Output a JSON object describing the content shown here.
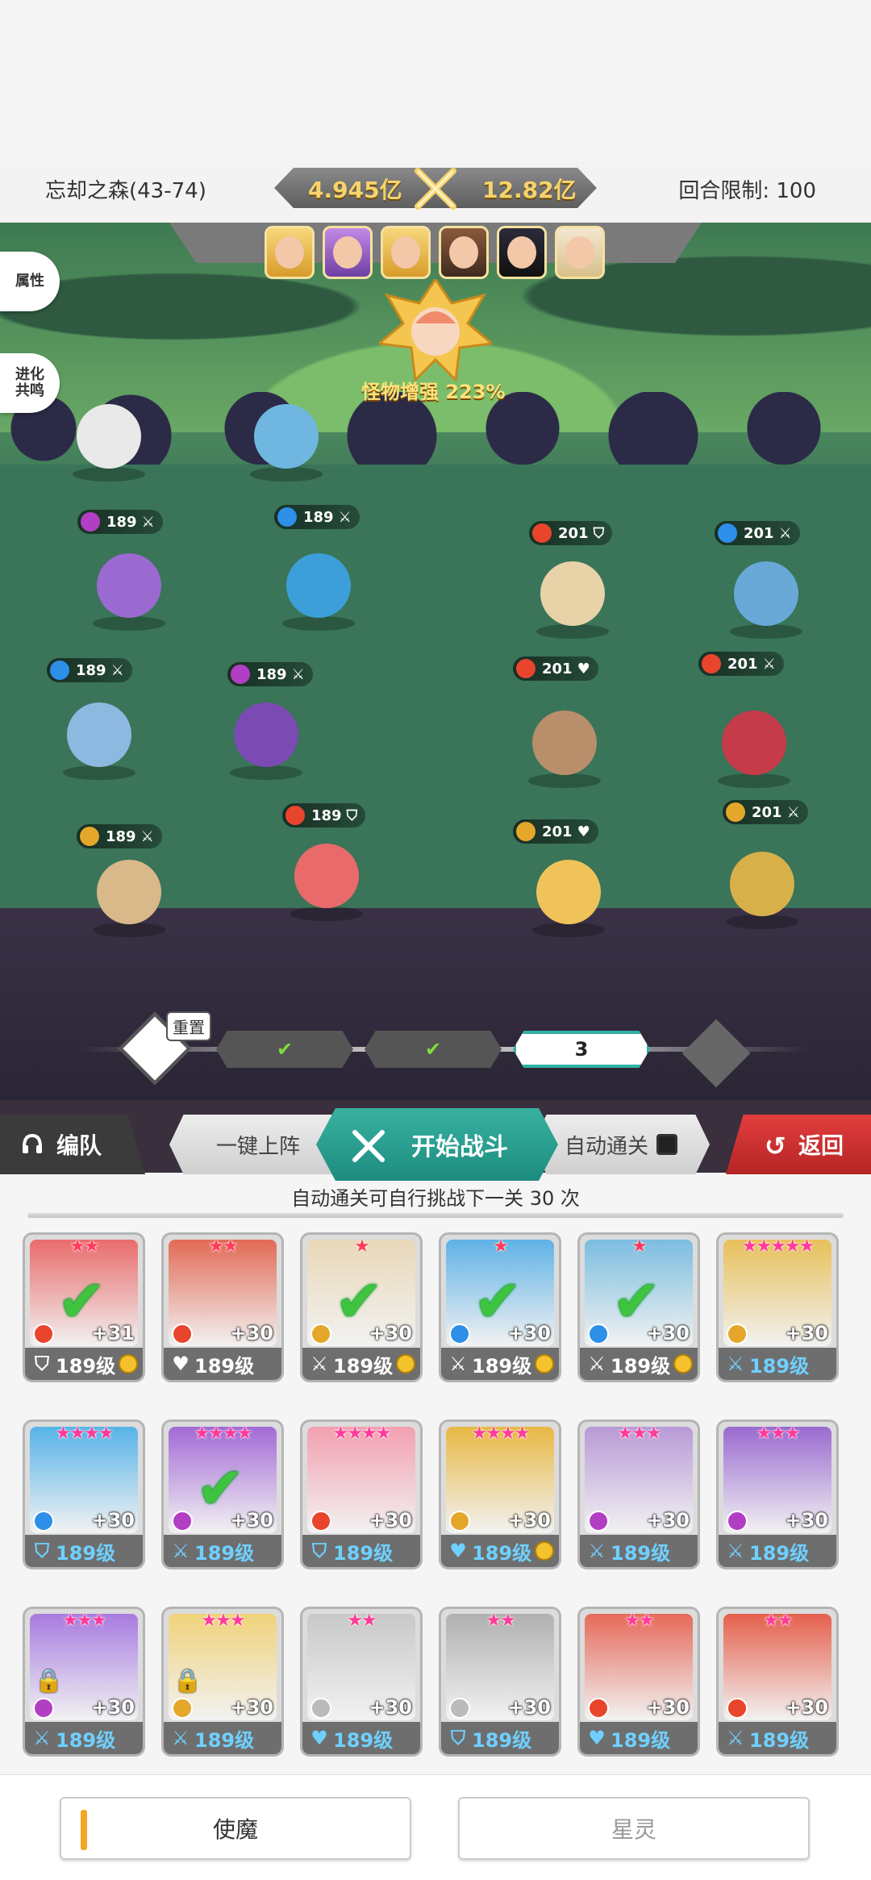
{
  "header": {
    "stage_name": "忘却之森(43-74)",
    "power_left": "4.945亿",
    "power_right": "12.82亿",
    "round_limit": "回合限制: 100"
  },
  "battle": {
    "side_buttons": [
      "属性",
      "进化\n共鸣"
    ],
    "boss_buff": "怪物增强 223%",
    "enemy_portraits": 6,
    "ally_tags": [
      {
        "level": "189",
        "element": "moon",
        "role": "sword"
      },
      {
        "level": "189",
        "element": "water",
        "role": "sword"
      },
      {
        "level": "189",
        "element": "water",
        "role": "sword"
      },
      {
        "level": "189",
        "element": "moon",
        "role": "sword"
      },
      {
        "level": "189",
        "element": "fire",
        "role": "shield"
      },
      {
        "level": "189",
        "element": "wind",
        "role": "sword"
      }
    ],
    "enemy_tags": [
      {
        "level": "201",
        "element": "fire",
        "role": "shield"
      },
      {
        "level": "201",
        "element": "water",
        "role": "sword"
      },
      {
        "level": "201",
        "element": "fire",
        "role": "heart"
      },
      {
        "level": "201",
        "element": "fire",
        "role": "sword"
      },
      {
        "level": "201",
        "element": "wind",
        "role": "sword"
      },
      {
        "level": "201",
        "element": "wind",
        "role": "heart"
      }
    ]
  },
  "stages": {
    "reset_label": "重置",
    "current": "3"
  },
  "actions": {
    "team_label": "编队",
    "one_click_label": "一键上阵",
    "start_label": "开始战斗",
    "auto_label": "自动通关",
    "back_label": "返回"
  },
  "auto_info": "自动通关可自行挑战下一关 30 次",
  "roster": [
    {
      "stars": "★★",
      "bonus": "+31",
      "level": "189级",
      "checked": true,
      "elem_color": "#e8452c",
      "role": "shield",
      "coin": true,
      "blue": false,
      "art": "#e96b6b",
      "star_color": "#ff3b5c"
    },
    {
      "stars": "★★",
      "bonus": "+30",
      "level": "189级",
      "checked": false,
      "elem_color": "#e8452c",
      "role": "heart",
      "coin": false,
      "blue": false,
      "art": "#e26a55",
      "star_color": "#ff3b5c"
    },
    {
      "stars": "★",
      "bonus": "+30",
      "level": "189级",
      "checked": true,
      "elem_color": "#e4a72a",
      "role": "sword",
      "coin": true,
      "blue": false,
      "art": "#e9d8b8",
      "star_color": "#ff3b5c"
    },
    {
      "stars": "★",
      "bonus": "+30",
      "level": "189级",
      "checked": true,
      "elem_color": "#2d8fe8",
      "role": "sword",
      "coin": true,
      "blue": false,
      "art": "#5fb2e6",
      "star_color": "#ff3b5c"
    },
    {
      "stars": "★",
      "bonus": "+30",
      "level": "189级",
      "checked": true,
      "elem_color": "#2d8fe8",
      "role": "sword",
      "coin": true,
      "blue": false,
      "art": "#7bbde0",
      "star_color": "#ff3b5c"
    },
    {
      "stars": "★★★★★",
      "bonus": "+30",
      "level": "189级",
      "checked": false,
      "elem_color": "#e4a72a",
      "role": "sword",
      "coin": false,
      "blue": true,
      "art": "#e8c05a",
      "star_color": "#ff3b9a"
    },
    {
      "stars": "★★★★",
      "bonus": "+30",
      "level": "189级",
      "checked": false,
      "elem_color": "#2d8fe8",
      "role": "shield",
      "coin": false,
      "blue": true,
      "art": "#56b3e8",
      "star_color": "#ff3b9a"
    },
    {
      "stars": "★★★★",
      "bonus": "+30",
      "level": "189级",
      "checked": true,
      "elem_color": "#b23ec4",
      "role": "sword",
      "coin": false,
      "blue": true,
      "art": "#a36ad6",
      "star_color": "#ff3b9a"
    },
    {
      "stars": "★★★★",
      "bonus": "+30",
      "level": "189级",
      "checked": false,
      "elem_color": "#e8452c",
      "role": "shield",
      "coin": false,
      "blue": true,
      "art": "#f2a0b0",
      "star_color": "#ff3b9a"
    },
    {
      "stars": "★★★★",
      "bonus": "+30",
      "level": "189级",
      "checked": false,
      "elem_color": "#e4a72a",
      "role": "heart",
      "coin": true,
      "blue": true,
      "art": "#e8b845",
      "star_color": "#ff3b9a"
    },
    {
      "stars": "★★★",
      "bonus": "+30",
      "level": "189级",
      "checked": false,
      "elem_color": "#b23ec4",
      "role": "sword",
      "coin": false,
      "blue": true,
      "art": "#b89ad6",
      "star_color": "#ff3b9a"
    },
    {
      "stars": "★★★",
      "bonus": "+30",
      "level": "189级",
      "checked": false,
      "elem_color": "#b23ec4",
      "role": "sword",
      "coin": false,
      "blue": true,
      "art": "#9a6ad0",
      "star_color": "#ff3b9a"
    },
    {
      "stars": "★★★",
      "bonus": "+30",
      "level": "189级",
      "checked": false,
      "elem_color": "#b23ec4",
      "role": "sword",
      "coin": false,
      "blue": true,
      "art": "#a77be0",
      "star_color": "#ff3b9a",
      "lock": true
    },
    {
      "stars": "★★★",
      "bonus": "+30",
      "level": "189级",
      "checked": false,
      "elem_color": "#e4a72a",
      "role": "sword",
      "coin": false,
      "blue": true,
      "art": "#f0d27a",
      "star_color": "#ff3b9a",
      "lock": true
    },
    {
      "stars": "★★",
      "bonus": "+30",
      "level": "189级",
      "checked": false,
      "elem_color": "#bbbbbb",
      "role": "heart",
      "coin": false,
      "blue": true,
      "art": "#c8c8c8",
      "star_color": "#ff3b9a"
    },
    {
      "stars": "★★",
      "bonus": "+30",
      "level": "189级",
      "checked": false,
      "elem_color": "#bbbbbb",
      "role": "shield",
      "coin": false,
      "blue": true,
      "art": "#b0b0b0",
      "star_color": "#ff3b9a"
    },
    {
      "stars": "★★",
      "bonus": "+30",
      "level": "189级",
      "checked": false,
      "elem_color": "#e8452c",
      "role": "heart",
      "coin": false,
      "blue": true,
      "art": "#e66a5a",
      "star_color": "#ff3b9a"
    },
    {
      "stars": "★★",
      "bonus": "+30",
      "level": "189级",
      "checked": false,
      "elem_color": "#e8452c",
      "role": "sword",
      "coin": false,
      "blue": true,
      "art": "#e5604c",
      "star_color": "#ff3b9a"
    }
  ],
  "tabs": {
    "active": "使魔",
    "inactive": "星灵"
  }
}
